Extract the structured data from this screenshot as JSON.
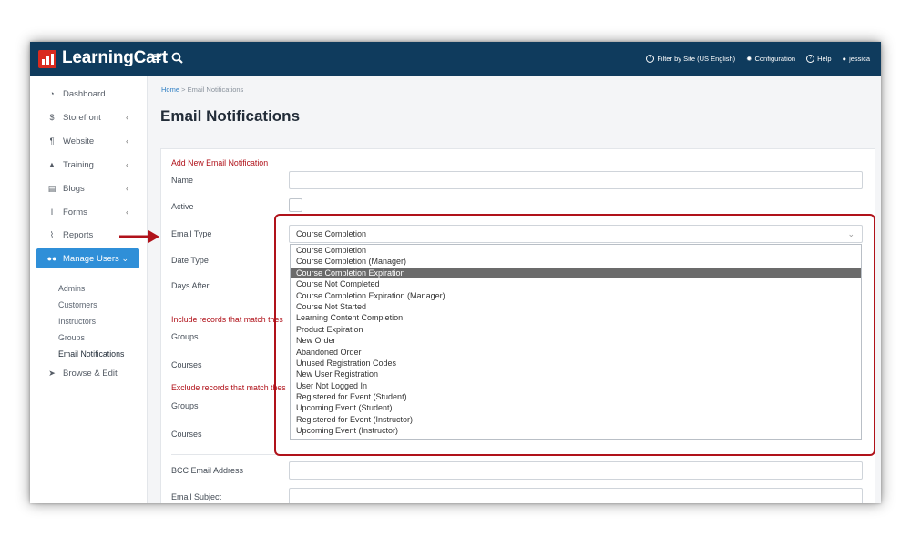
{
  "brand": {
    "name": "LearningCart"
  },
  "topbar": {
    "filter_label": "Filter by Site (US English)",
    "config_label": "Configuration",
    "help_label": "Help",
    "user_label": "jessica"
  },
  "sidebar": {
    "items": [
      {
        "label": "Dashboard",
        "icon": "dashboard-icon"
      },
      {
        "label": "Storefront",
        "icon": "dollar-icon"
      },
      {
        "label": "Website",
        "icon": "paragraph-icon"
      },
      {
        "label": "Training",
        "icon": "graduation-cap-icon"
      },
      {
        "label": "Blogs",
        "icon": "newspaper-icon"
      },
      {
        "label": "Forms",
        "icon": "text-cursor-icon"
      },
      {
        "label": "Reports",
        "icon": "line-chart-icon"
      },
      {
        "label": "Manage Users",
        "icon": "users-icon"
      }
    ],
    "subitems": [
      "Admins",
      "Customers",
      "Instructors",
      "Groups",
      "Email Notifications"
    ],
    "browse_label": "Browse & Edit",
    "accent": "#2f8fd8"
  },
  "breadcrumb": {
    "home": "Home",
    "sep": ">",
    "current": "Email Notifications"
  },
  "page_title": "Email Notifications",
  "form": {
    "section_add": "Add New Email Notification",
    "name_label": "Name",
    "active_label": "Active",
    "email_type_label": "Email Type",
    "email_type_value": "Course Completion",
    "date_type_label": "Date Type",
    "days_after_label": "Days After",
    "include_label": "Include records that match thes",
    "groups_label": "Groups",
    "courses_label": "Courses",
    "exclude_label": "Exclude records that match thes",
    "groups2_label": "Groups",
    "courses2_label": "Courses",
    "bcc_label": "BCC Email Address",
    "subject_label": "Email Subject"
  },
  "dropdown": {
    "options": [
      "Course Completion",
      "Course Completion (Manager)",
      "Course Completion Expiration",
      "Course Not Completed",
      "Course Completion Expiration (Manager)",
      "Course Not Started",
      "Learning Content Completion",
      "Product Expiration",
      "New Order",
      "Abandoned Order",
      "Unused Registration Codes",
      "New User Registration",
      "User Not Logged In",
      "Registered for Event (Student)",
      "Upcoming Event (Student)",
      "Registered for Event (Instructor)",
      "Upcoming Event (Instructor)"
    ],
    "highlighted": "Course Completion Expiration"
  },
  "colors": {
    "topbar": "#0f3b5d",
    "annotation": "#b0121a",
    "brand_red": "#d92b1f"
  }
}
